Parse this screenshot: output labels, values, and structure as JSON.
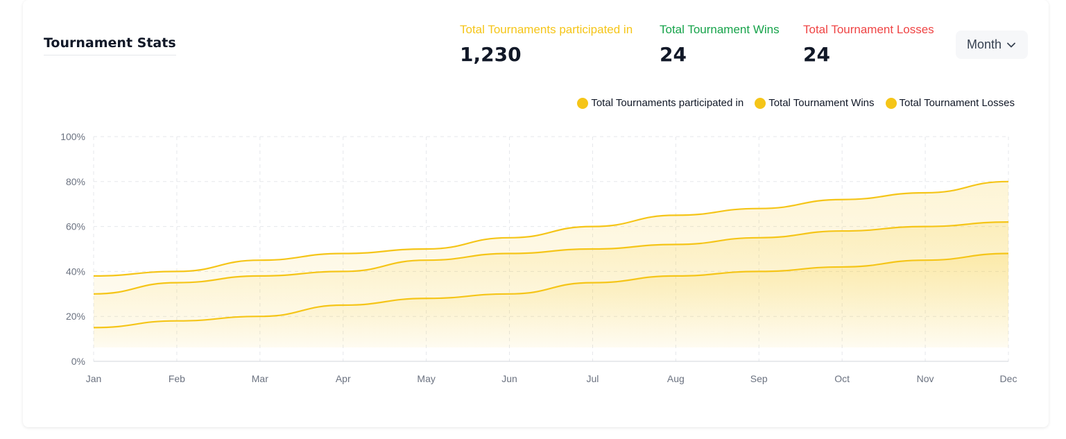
{
  "header": {
    "title": "Tournament Stats",
    "period_select": "Month"
  },
  "stats": [
    {
      "label": "Total Tournaments participated in",
      "value": "1,230",
      "color": "#f5c518"
    },
    {
      "label": "Total Tournament Wins",
      "value": "24",
      "color": "#16a34a"
    },
    {
      "label": "Total Tournament Losses",
      "value": "24",
      "color": "#ef4444"
    }
  ],
  "colors": {
    "series": "#f5c518",
    "grid": "#e5e7eb",
    "axis_text": "#6b7280"
  },
  "chart_data": {
    "type": "area",
    "title": "",
    "xlabel": "",
    "ylabel": "",
    "categories": [
      "Jan",
      "Feb",
      "Mar",
      "Apr",
      "May",
      "Jun",
      "Jul",
      "Aug",
      "Sep",
      "Oct",
      "Nov",
      "Dec"
    ],
    "y_ticks": [
      "0%",
      "20%",
      "40%",
      "60%",
      "80%",
      "100%"
    ],
    "ylim": [
      0,
      100
    ],
    "y_unit": "%",
    "grid": true,
    "legend_position": "top-right",
    "series": [
      {
        "name": "Total Tournaments participated in",
        "values": [
          38,
          40,
          45,
          48,
          50,
          55,
          60,
          65,
          68,
          72,
          75,
          80
        ]
      },
      {
        "name": "Total Tournament Wins",
        "values": [
          30,
          35,
          38,
          40,
          45,
          48,
          50,
          52,
          55,
          58,
          60,
          62
        ]
      },
      {
        "name": "Total Tournament Losses",
        "values": [
          15,
          18,
          20,
          25,
          28,
          30,
          35,
          38,
          40,
          42,
          45,
          48
        ]
      }
    ]
  }
}
